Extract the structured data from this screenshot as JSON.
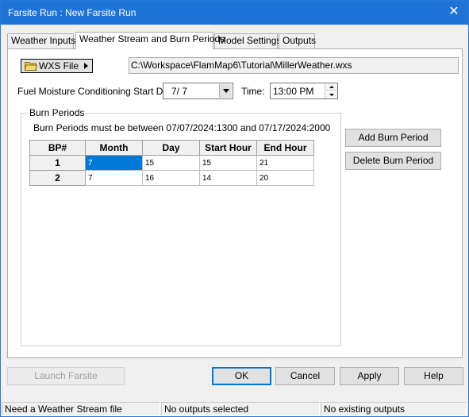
{
  "window": {
    "title": "Farsite Run : New Farsite Run",
    "close_glyph": "✕"
  },
  "tabs": [
    {
      "label": "Weather Inputs"
    },
    {
      "label": "Weather Stream and Burn Periods"
    },
    {
      "label": "Model Settings"
    },
    {
      "label": "Outputs"
    }
  ],
  "weather": {
    "wxs_button_label": "WXS File",
    "wxs_path": "C:\\Workspace\\FlamMap6\\Tutorial\\MillerWeather.wxs",
    "conditioning_label": "Fuel Moisture Conditioning Start Day:",
    "conditioning_value": "7/  7",
    "time_label": "Time:",
    "time_value": "13:00 PM"
  },
  "burn_periods": {
    "group_label": "Burn Periods",
    "range_text": "Burn Periods must be between 07/07/2024:1300 and 07/17/2024:2000",
    "columns": [
      "BP#",
      "Month",
      "Day",
      "Start Hour",
      "End Hour"
    ],
    "rows": [
      {
        "bp": "1",
        "month": "7",
        "day": "15",
        "start": "15",
        "end": "21"
      },
      {
        "bp": "2",
        "month": "7",
        "day": "16",
        "start": "14",
        "end": "20"
      }
    ],
    "add_label": "Add Burn Period",
    "delete_label": "Delete Burn Period"
  },
  "footer": {
    "launch_label": "Launch Farsite",
    "ok_label": "OK",
    "cancel_label": "Cancel",
    "apply_label": "Apply",
    "help_label": "Help"
  },
  "status": [
    "Need a Weather Stream file",
    "No outputs selected",
    "No existing outputs"
  ],
  "colors": {
    "titlebar": "#1e73d6",
    "selection": "#0078d7"
  },
  "icons": {
    "wxs_button_icon": "folder-open-icon",
    "close": "close-icon"
  }
}
